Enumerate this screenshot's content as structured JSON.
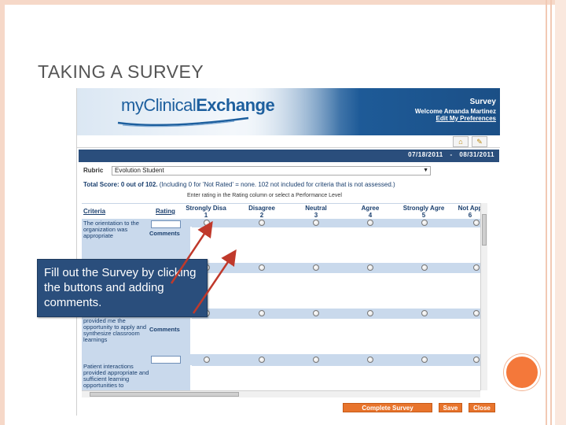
{
  "slide": {
    "title": "TAKING A SURVEY"
  },
  "app": {
    "logo_text_light": "myClinical",
    "logo_text_bold": "Exchange",
    "page_name": "Survey",
    "welcome": "Welcome Amanda Martinez",
    "edit_prefs": "Edit My Preferences"
  },
  "toolbar": {
    "icons": [
      "home-icon",
      "edit-icon"
    ]
  },
  "dates": {
    "start": "07/18/2011",
    "end": "08/31/2011"
  },
  "rubric": {
    "label": "Rubric",
    "selected": "Evolution    Student"
  },
  "score": {
    "label": "Total Score: 0 out of 102.",
    "note": " (Including 0 for 'Not Rated' = none. 102 not included for criteria that is not assessed.)"
  },
  "instructions": "Enter rating in the Rating column or select a Performance Level",
  "table": {
    "col_criteria": "Criteria",
    "col_rating": "Rating",
    "levels": [
      {
        "label": "Strongly Disa",
        "num": "1"
      },
      {
        "label": "Disagree",
        "num": "2"
      },
      {
        "label": "Neutral",
        "num": "3"
      },
      {
        "label": "Agree",
        "num": "4"
      },
      {
        "label": "Strongly Agre",
        "num": "5"
      },
      {
        "label": "Not App",
        "num": "6"
      }
    ],
    "comments_label": "Comments",
    "rows": [
      {
        "criteria": "The orientation to the organization was appropriate"
      },
      {
        "criteria": ""
      },
      {
        "criteria": "provided me the opportunity to apply and synthesize classroom learnings"
      },
      {
        "criteria": "Patient interactions provided appropriate and sufficient learning opportunities to"
      }
    ]
  },
  "buttons": {
    "complete": "Complete Survey",
    "save": "Save",
    "close": "Close"
  },
  "callout": {
    "text": "Fill out the Survey by clicking the buttons and adding comments."
  },
  "colors": {
    "accent": "#e8742c",
    "header_blue": "#1b4f86",
    "band_blue": "#c9d9ec",
    "callout_bg": "#2a4e7c",
    "arrow_red": "#c0392b"
  }
}
